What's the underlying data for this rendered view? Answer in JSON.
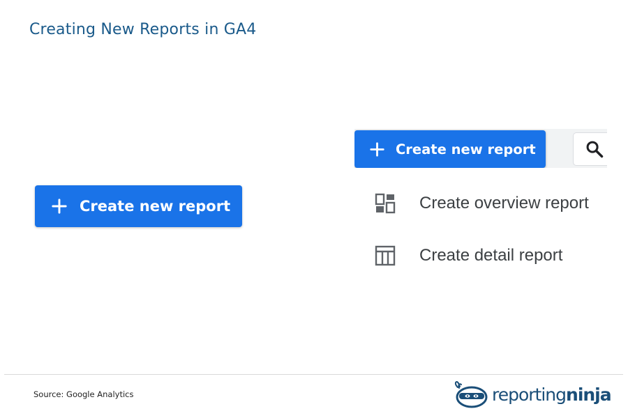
{
  "page": {
    "title": "Creating New Reports in GA4"
  },
  "left_button": {
    "label": "Create new report",
    "icon": "plus-icon"
  },
  "right_panel": {
    "create_button": {
      "label": "Create new report",
      "icon": "plus-icon"
    },
    "search_icon": "search-icon",
    "menu": [
      {
        "label": "Create overview report",
        "icon": "dashboard-icon"
      },
      {
        "label": "Create detail report",
        "icon": "table-icon"
      }
    ]
  },
  "footer": {
    "source": "Source: Google Analytics",
    "logo_word_1": "reporting",
    "logo_word_2": "ninja"
  },
  "colors": {
    "title": "#1a5a8a",
    "button": "#1a73e8",
    "button_text": "#ffffff",
    "menu_text": "#3c4043",
    "menu_icon": "#5f6368",
    "logo": "#1a4e78"
  }
}
